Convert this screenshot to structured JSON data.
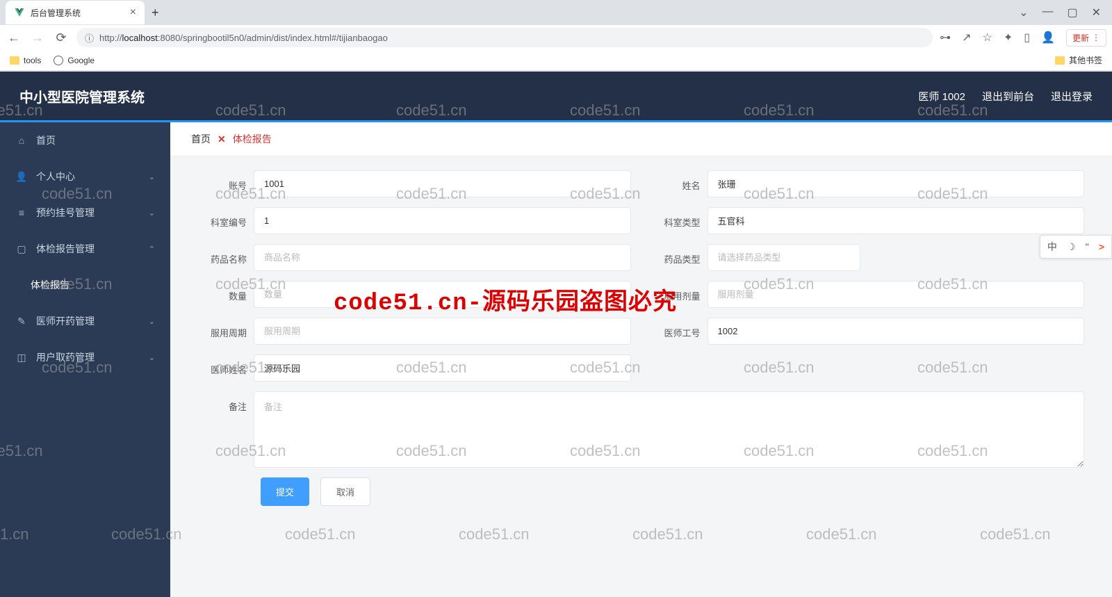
{
  "browser": {
    "tab_title": "后台管理系统",
    "url_prefix": "http://",
    "url_host": "localhost",
    "url_port_path": ":8080/springbootil5n0/admin/dist/index.html#/tijianbaogao",
    "update_label": "更新",
    "bookmarks": {
      "tools": "tools",
      "google": "Google",
      "other": "其他书签"
    }
  },
  "app": {
    "title": "中小型医院管理系统",
    "user": "医师 1002",
    "back_front": "退出到前台",
    "logout": "退出登录"
  },
  "sidebar": {
    "home": "首页",
    "personal": "个人中心",
    "appointment": "预约挂号管理",
    "report_mgmt": "体检报告管理",
    "report_sub": "体检报告",
    "doctor_med": "医师开药管理",
    "user_med": "用户取药管理"
  },
  "breadcrumb": {
    "home": "首页",
    "close": "✕",
    "current": "体检报告"
  },
  "form": {
    "account": {
      "label": "账号",
      "value": "1001"
    },
    "name": {
      "label": "姓名",
      "value": "张珊"
    },
    "dept_no": {
      "label": "科室编号",
      "value": "1"
    },
    "dept_type": {
      "label": "科室类型",
      "value": "五官科"
    },
    "drug_name": {
      "label": "药品名称",
      "placeholder": "商品名称"
    },
    "drug_type": {
      "label": "药品类型",
      "placeholder": "请选择药品类型"
    },
    "qty": {
      "label": "数量",
      "placeholder": "数量"
    },
    "dose": {
      "label": "服用剂量",
      "placeholder": "服用剂量"
    },
    "cycle": {
      "label": "服用周期",
      "placeholder": "服用周期"
    },
    "doc_no": {
      "label": "医师工号",
      "value": "1002"
    },
    "doc_name": {
      "label": "医师姓名",
      "value": "源码乐园"
    },
    "remark": {
      "label": "备注",
      "placeholder": "备注"
    },
    "submit": "提交",
    "cancel": "取消"
  },
  "watermark": {
    "text": "code51.cn",
    "red": "code51.cn-源码乐园盗图必究"
  },
  "ime": {
    "zh": "中",
    "quote": "''",
    "arrow": ">"
  }
}
